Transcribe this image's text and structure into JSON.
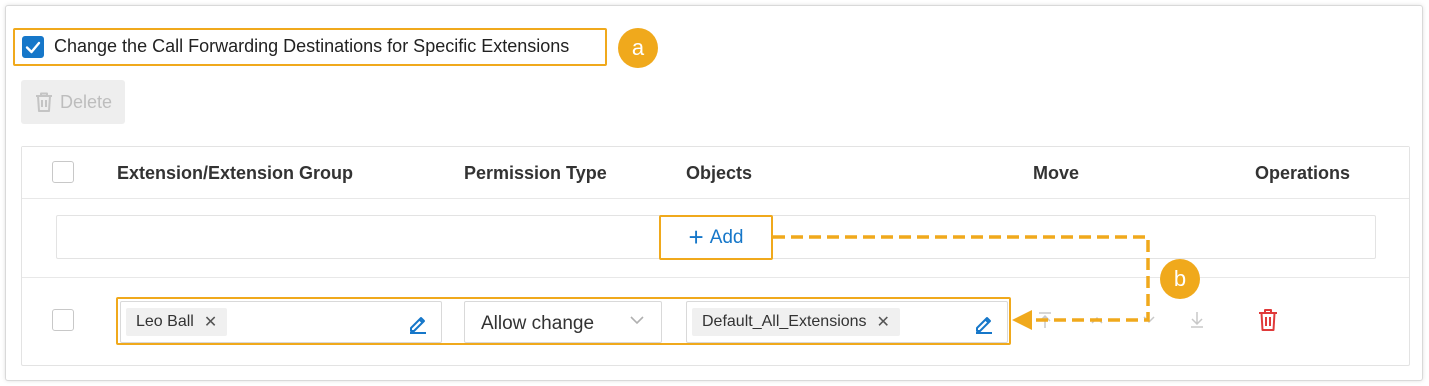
{
  "header": {
    "checkbox_label": "Change the Call Forwarding Destinations for Specific Extensions",
    "checked": true
  },
  "callouts": {
    "a": "a",
    "b": "b"
  },
  "toolbar": {
    "delete_label": "Delete"
  },
  "table": {
    "columns": [
      "Extension/Extension Group",
      "Permission Type",
      "Objects",
      "Move",
      "Operations"
    ],
    "add_label": "Add",
    "rows": [
      {
        "extension_tag": "Leo Ball",
        "permission_type": "Allow change",
        "objects_tag": "Default_All_Extensions"
      }
    ]
  },
  "colors": {
    "accent": "#1677c9",
    "highlight": "#f0a91c",
    "danger": "#e03a3a"
  },
  "icons": [
    "check-icon",
    "trash-icon",
    "plus-icon",
    "close-icon",
    "edit-icon",
    "chevron-down-icon",
    "move-top-icon",
    "move-up-icon",
    "move-down-icon",
    "move-bottom-icon"
  ]
}
